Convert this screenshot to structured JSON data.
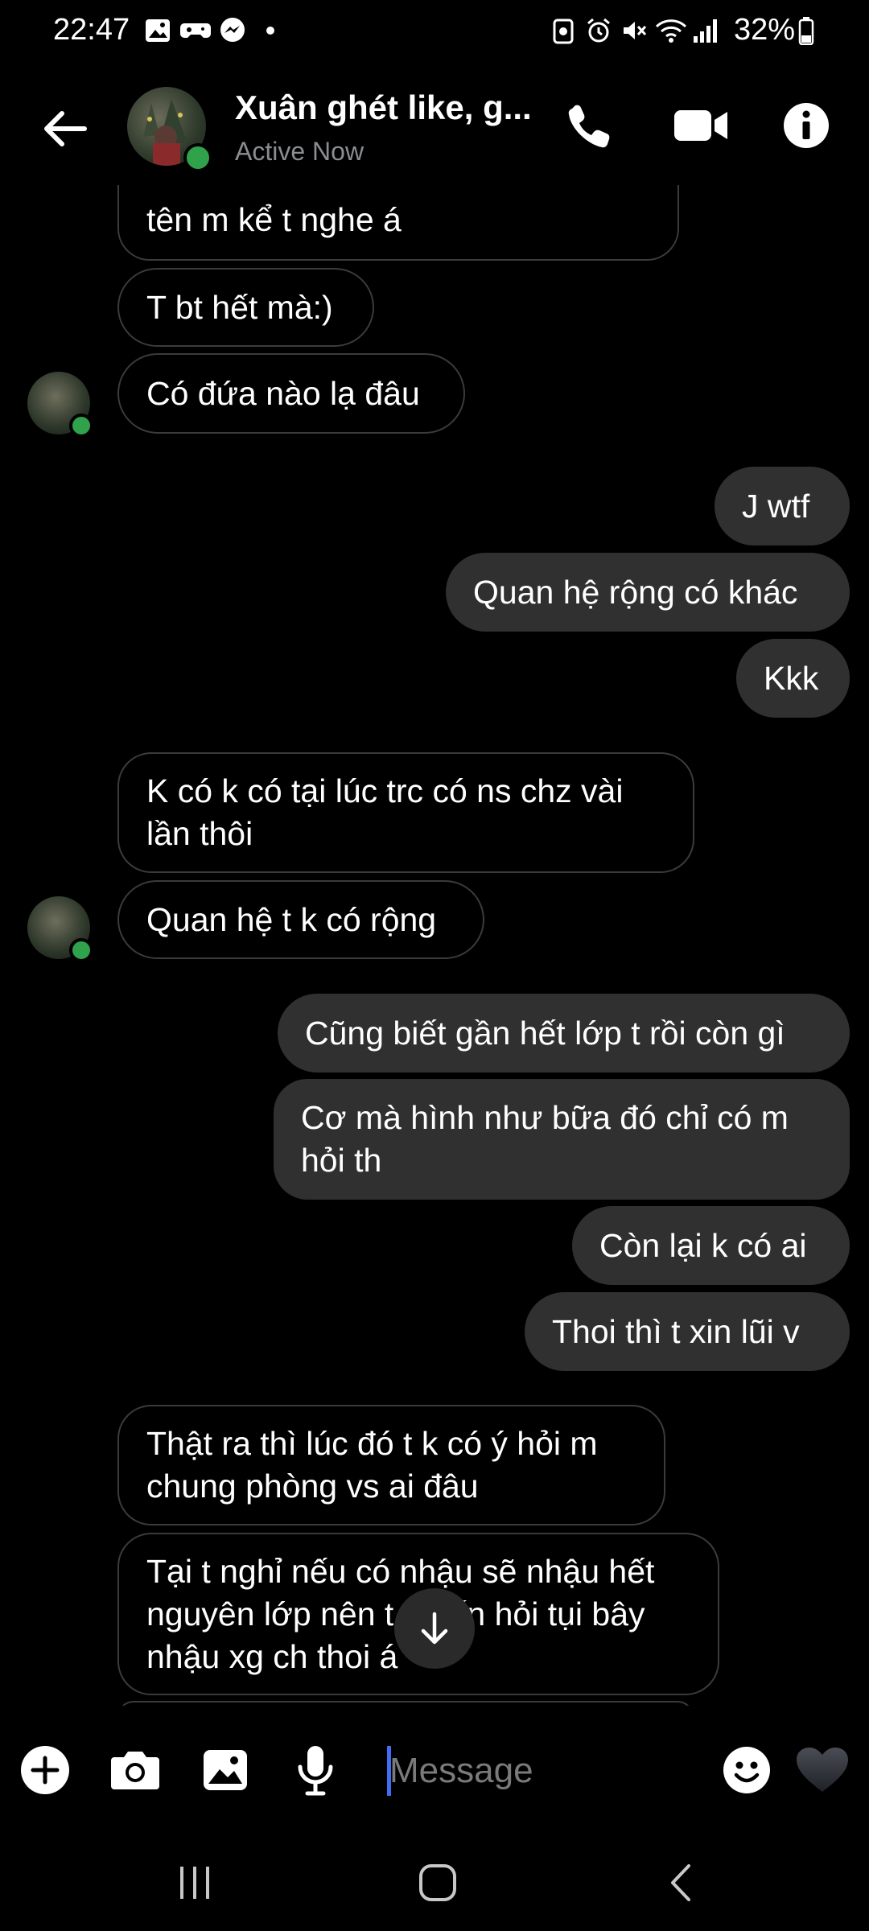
{
  "status_bar": {
    "time": "22:47",
    "battery": "32%",
    "left_icons": [
      "gallery-icon",
      "game-icon",
      "messenger-icon",
      "dot-icon"
    ],
    "right_icons": [
      "storage-icon",
      "alarm-icon",
      "mute-icon",
      "wifi-icon",
      "signal-icon",
      "battery-icon"
    ]
  },
  "header": {
    "title": "Xuân ghét like, g...",
    "status": "Active Now"
  },
  "messages": [
    {
      "side": "received",
      "text": "tên m kể t nghe á"
    },
    {
      "side": "received",
      "text": "T bt hết mà:)"
    },
    {
      "side": "received",
      "text": "Có đứa nào lạ đâu"
    },
    {
      "side": "sent",
      "text": "J wtf"
    },
    {
      "side": "sent",
      "text": "Quan hệ rộng có khác"
    },
    {
      "side": "sent",
      "text": "Kkk"
    },
    {
      "side": "received",
      "lines": [
        "K có k có tại lúc trc có ns chz vài",
        "lần thôi"
      ]
    },
    {
      "side": "received",
      "text": "Quan hệ t k có rộng"
    },
    {
      "side": "sent",
      "text": "Cũng biết gần hết lớp t rồi còn gì"
    },
    {
      "side": "sent",
      "lines": [
        "Cơ mà hình như bữa đó chỉ có m",
        "hỏi th"
      ]
    },
    {
      "side": "sent",
      "text": "Còn lại k có ai"
    },
    {
      "side": "sent",
      "text": "Thoi thì t xin lũi v"
    },
    {
      "side": "received",
      "lines": [
        "Thật ra thì lúc đó t k có ý hỏi m",
        "chung phòng vs ai đâu"
      ]
    },
    {
      "side": "received",
      "lines": [
        "Tại t nghỉ nếu có nhậu sẽ nhậu hết",
        "nguyên lớp nên t muốn hỏi tụi bây",
        "nhậu xg ch thoi á"
      ]
    }
  ],
  "composer": {
    "placeholder": "Message"
  },
  "colors": {
    "background": "#000000",
    "sent_bubble": "#303030",
    "received_border": "#3a3b3c",
    "online": "#31a24c",
    "caret": "#3f6ef5"
  }
}
